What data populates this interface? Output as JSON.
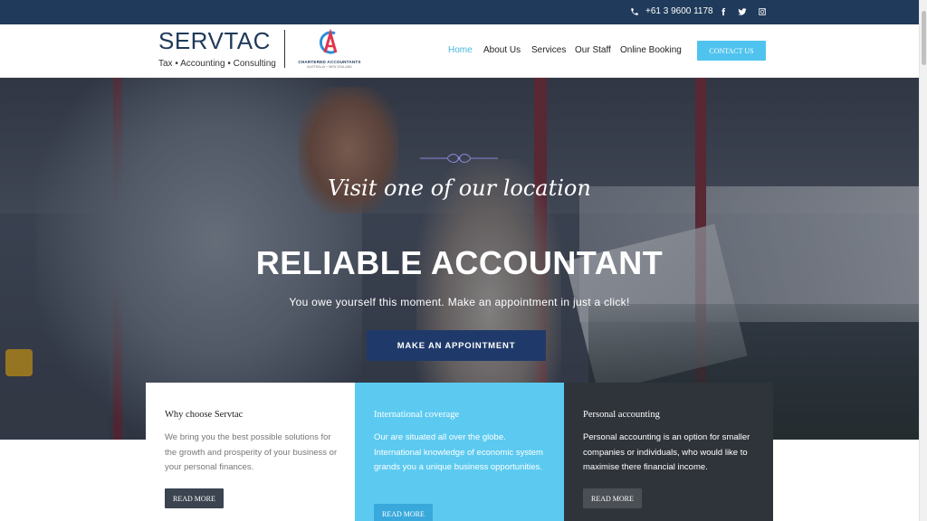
{
  "topbar": {
    "phone": "+61 3 9600 1178",
    "social": [
      "facebook-icon",
      "twitter-icon",
      "instagram-icon"
    ]
  },
  "header": {
    "logo_word": "SERVTAC",
    "logo_tagline": "Tax • Accounting • Consulting",
    "partner_logo_name": "CHARTERED ACCOUNTANTS",
    "partner_logo_sub": "AUSTRALIA + NEW ZEALAND",
    "nav": [
      {
        "label": "Home",
        "active": true
      },
      {
        "label": "About Us",
        "active": false
      },
      {
        "label": "Services",
        "active": false
      },
      {
        "label": "Our Staff",
        "active": false
      },
      {
        "label": "Online Booking",
        "active": false
      }
    ],
    "contact_button": "CONTACT US"
  },
  "hero": {
    "script_text": "Visit one of our location",
    "headline": "RELIABLE ACCOUNTANT",
    "subline": "You owe yourself this moment. Make an appointment in just a click!",
    "cta": "MAKE AN APPOINTMENT"
  },
  "cards": [
    {
      "title": "Why choose Servtac",
      "body": "We bring you the best possible solutions for the growth and prosperity of your business or your personal finances.",
      "button": "READ MORE"
    },
    {
      "title": "International coverage",
      "body": "Our are situated all over the globe. International knowledge of economic system grands you a unique business opportunities.",
      "button": "READ MORE"
    },
    {
      "title": "Personal accounting",
      "body": "Personal accounting is an option for smaller companies or individuals, who would like to maximise there financial income.",
      "button": "READ MORE"
    }
  ],
  "colors": {
    "navy": "#1f3a5a",
    "accent": "#4fc3ee",
    "cta": "#1f3a6a",
    "dark_card": "#2f343a"
  }
}
